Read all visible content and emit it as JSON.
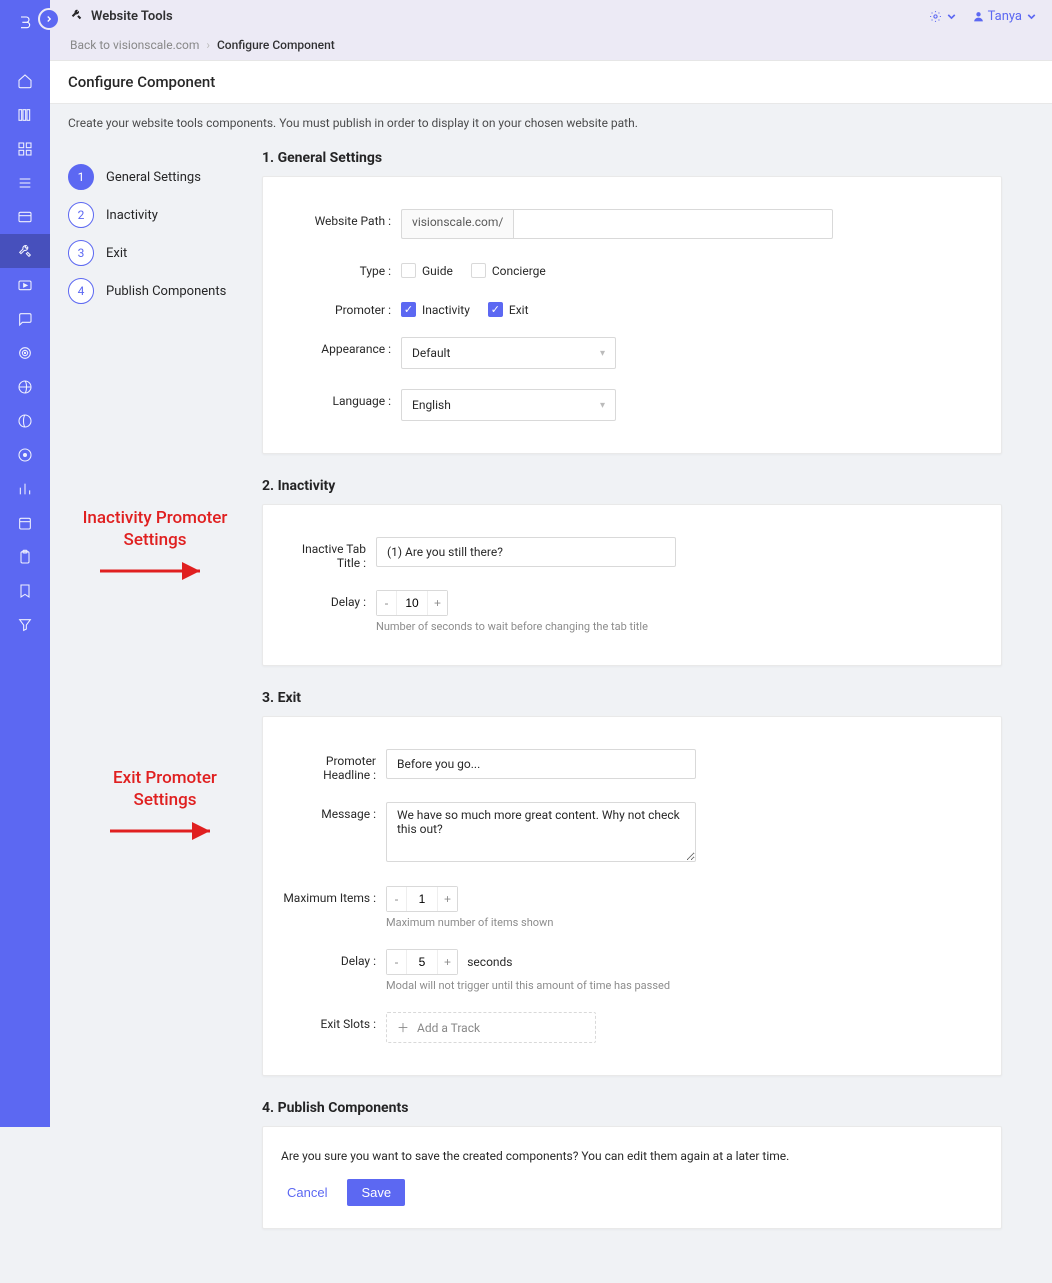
{
  "app_title": "Website Tools",
  "user_name": "Tanya",
  "breadcrumb": {
    "back": "Back to visionscale.com",
    "current": "Configure Component"
  },
  "page_title": "Configure Component",
  "intro": "Create your website tools components. You must publish in order to display it on your chosen website path.",
  "steps": [
    {
      "num": "1",
      "label": "General Settings"
    },
    {
      "num": "2",
      "label": "Inactivity"
    },
    {
      "num": "3",
      "label": "Exit"
    },
    {
      "num": "4",
      "label": "Publish Components"
    }
  ],
  "sections": {
    "general": {
      "heading": "1. General Settings",
      "website_path_label": "Website Path",
      "website_path_prefix": "visionscale.com/",
      "website_path_value": "",
      "type_label": "Type",
      "type_options": {
        "guide": "Guide",
        "concierge": "Concierge"
      },
      "promoter_label": "Promoter",
      "promoter_options": {
        "inactivity": "Inactivity",
        "exit": "Exit"
      },
      "appearance_label": "Appearance",
      "appearance_value": "Default",
      "language_label": "Language",
      "language_value": "English"
    },
    "inactivity": {
      "heading": "2. Inactivity",
      "tab_title_label": "Inactive Tab Title",
      "tab_title_value": "(1) Are you still there?",
      "delay_label": "Delay",
      "delay_value": "10",
      "delay_hint": "Number of seconds to wait before changing the tab title"
    },
    "exit": {
      "heading": "3. Exit",
      "headline_label": "Promoter Headline",
      "headline_value": "Before you go...",
      "message_label": "Message",
      "message_value": "We have so much more great content. Why not check this out?",
      "max_items_label": "Maximum Items",
      "max_items_value": "1",
      "max_items_hint": "Maximum number of items shown",
      "delay_label": "Delay",
      "delay_value": "5",
      "delay_suffix": "seconds",
      "delay_hint": "Modal will not trigger until this amount of time has passed",
      "slots_label": "Exit Slots",
      "add_track": "Add a Track"
    },
    "publish": {
      "heading": "4. Publish Components",
      "text": "Are you sure you want to save the created components? You can edit them again at a later time.",
      "cancel": "Cancel",
      "save": "Save"
    }
  },
  "callouts": {
    "inactivity": "Inactivity Promoter Settings",
    "exit": "Exit Promoter Settings"
  }
}
